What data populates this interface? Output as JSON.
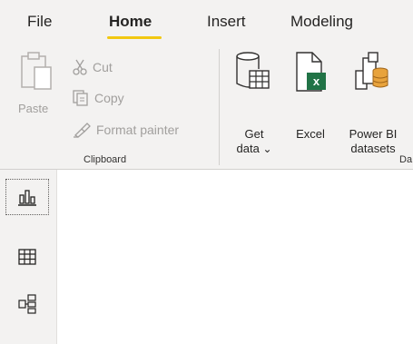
{
  "tabs": [
    {
      "label": "File"
    },
    {
      "label": "Home"
    },
    {
      "label": "Insert"
    },
    {
      "label": "Modeling"
    }
  ],
  "active_tab": "Home",
  "colors": {
    "accent_underline": "#f2c811",
    "ribbon_bg": "#f3f2f1",
    "excel_green": "#217346",
    "dataset_orange": "#e8a33c",
    "disabled_text": "#a19f9d"
  },
  "clipboard": {
    "paste_label": "Paste",
    "cut_label": "Cut",
    "copy_label": "Copy",
    "format_painter_label": "Format painter",
    "group_label": "Clipboard"
  },
  "data_group": {
    "get_data_line1": "Get",
    "get_data_line2": "data",
    "get_data_chevron": "⌄",
    "excel_label": "Excel",
    "powerbi_line1": "Power BI",
    "powerbi_line2": "datasets",
    "group_label_partial": "Da"
  },
  "icons": {
    "paste": "clipboard-icon",
    "cut": "scissors-icon",
    "copy": "copy-icon",
    "format_painter": "paintbrush-icon",
    "get_data": "database-table-icon",
    "excel": "excel-file-icon",
    "powerbi_datasets": "dataset-icon",
    "report_view": "bar-chart-icon",
    "data_view": "table-grid-icon",
    "model_view": "model-diagram-icon"
  }
}
